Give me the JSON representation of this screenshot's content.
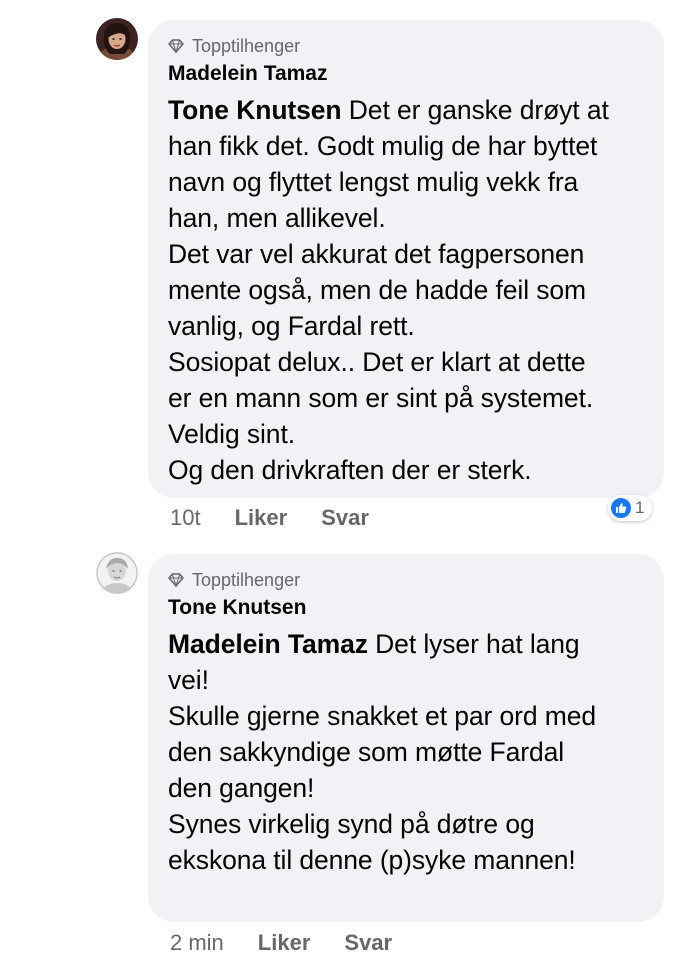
{
  "comments": [
    {
      "badge": "Topptilhenger",
      "author": "Madelein Tamaz",
      "mention": "Tone Knutsen",
      "lines": [
        " Det er ganske drøyt at",
        "han fikk det. Godt mulig de har byttet",
        "navn og flyttet lengst mulig vekk fra",
        "han, men allikevel.",
        "Det var vel akkurat det fagpersonen",
        "mente også, men de hadde feil som",
        "vanlig, og Fardal rett.",
        "Sosiopat delux.. Det er klart at dette",
        "er en mann som er sint på systemet.",
        "Veldig sint.",
        "Og den drivkraften der er sterk."
      ],
      "time": "10t",
      "like_label": "Liker",
      "reply_label": "Svar",
      "reaction_icon": "like-icon",
      "reaction_count": "1",
      "avatar_color": "#5a3a33"
    },
    {
      "badge": "Topptilhenger",
      "author": "Tone Knutsen",
      "mention": "Madelein Tamaz",
      "lines": [
        " Det lyser hat lang",
        "vei!",
        "Skulle gjerne snakket et par ord med",
        "den sakkyndige som møtte Fardal",
        "den gangen!",
        "Synes virkelig synd på døtre og",
        "ekskona til denne (p)syke mannen!"
      ],
      "time": "2 min",
      "like_label": "Liker",
      "reply_label": "Svar",
      "avatar_color": "#d9d9d9"
    }
  ]
}
